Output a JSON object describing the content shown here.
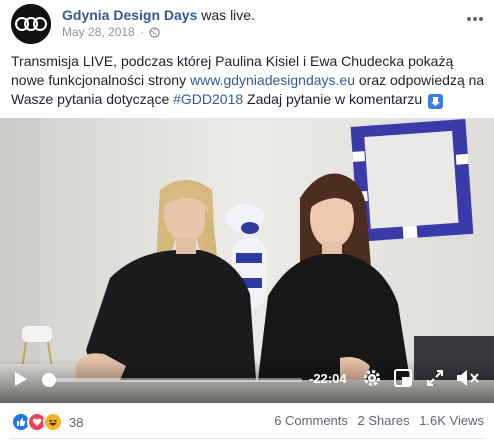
{
  "post": {
    "page_name": "Gdynia Design Days",
    "status_text": "was live.",
    "date": "May 28, 2018",
    "privacy_icon": "globe-icon",
    "avatar_logo": "GDD"
  },
  "text": {
    "part1": "Transmisja LIVE, podczas której Paulina Kisiel i Ewa Chudecka pokażą nowe funkcjonalności strony ",
    "link": "www.gdyniadesigndays.eu",
    "part2": " oraz odpowiedzą na Wasze pytania dotyczące ",
    "hashtag": "#GDD2018",
    "part3": " Zadaj pytanie w komentarzu "
  },
  "video": {
    "time_remaining": "-22:04",
    "progress": 0.02,
    "controls": [
      "play-icon",
      "gear-icon",
      "pip-icon",
      "fullscreen-icon",
      "mute-icon"
    ]
  },
  "footer": {
    "reaction_count": "38",
    "reactions": [
      "like",
      "love",
      "haha"
    ],
    "comments": "6 Comments",
    "shares": "2 Shares",
    "views": "1.6K Views"
  },
  "colors": {
    "link": "#365899",
    "like": "#1877f2",
    "love": "#f33e58",
    "haha": "#f7b125"
  }
}
